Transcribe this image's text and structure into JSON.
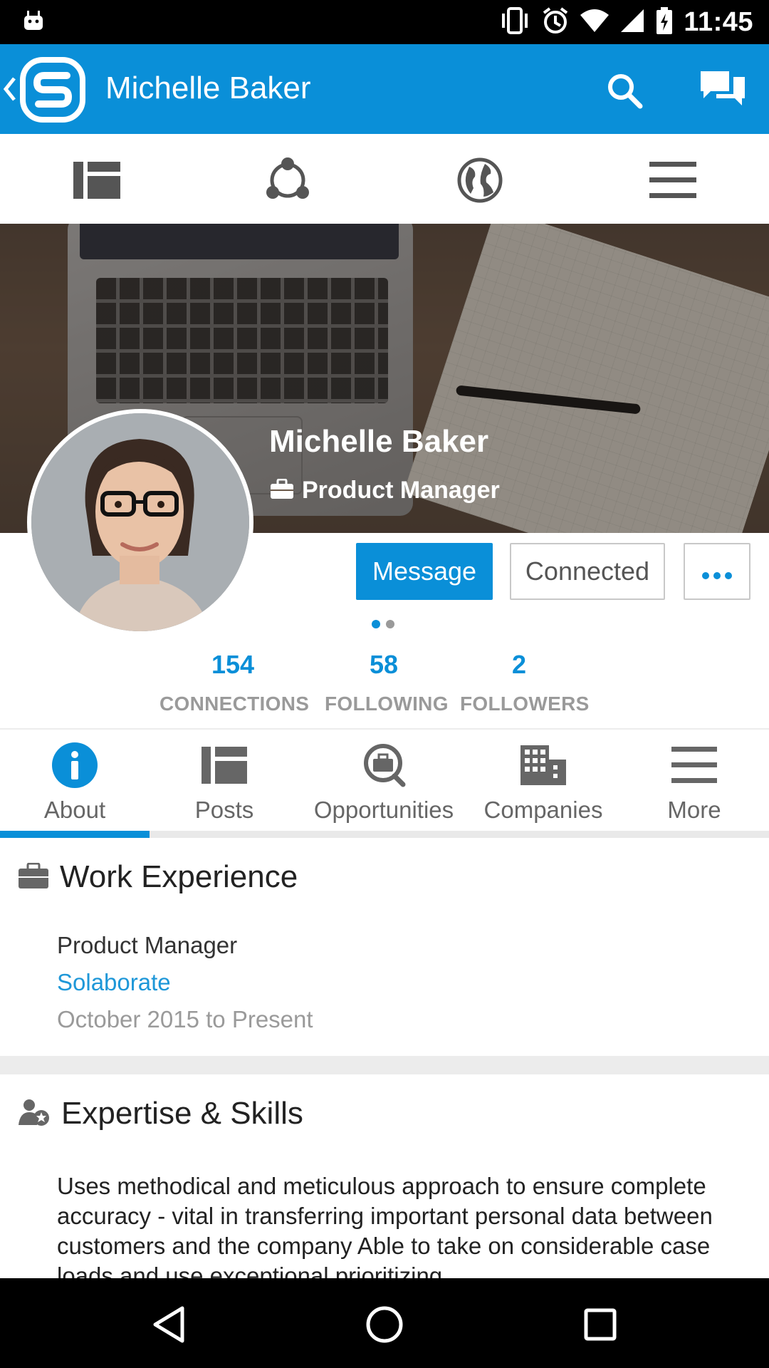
{
  "status_bar": {
    "time": "11:45"
  },
  "app_bar": {
    "title": "Michelle Baker"
  },
  "profile": {
    "name": "Michelle Baker",
    "role": "Product Manager"
  },
  "actions": {
    "message": "Message",
    "connected": "Connected"
  },
  "stats": [
    {
      "value": "154",
      "label": "CONNECTIONS"
    },
    {
      "value": "58",
      "label": "FOLLOWING"
    },
    {
      "value": "2",
      "label": "FOLLOWERS"
    }
  ],
  "tabs": [
    {
      "label": "About",
      "icon": "info-icon",
      "active": true
    },
    {
      "label": "Posts",
      "icon": "posts-icon"
    },
    {
      "label": "Opportunities",
      "icon": "opportunities-icon"
    },
    {
      "label": "Companies",
      "icon": "companies-icon"
    },
    {
      "label": "More",
      "icon": "menu-icon"
    }
  ],
  "work_experience": {
    "heading": "Work Experience",
    "title": "Product Manager",
    "company": "Solaborate",
    "dates": "October 2015 to Present"
  },
  "skills": {
    "heading": "Expertise & Skills",
    "text": "Uses methodical and meticulous approach to ensure complete accuracy - vital in transferring important personal data between customers and the company Able to take on considerable case loads and use exceptional prioritizing"
  },
  "colors": {
    "accent": "#0a8fd8",
    "muted": "#9a9a9a"
  }
}
